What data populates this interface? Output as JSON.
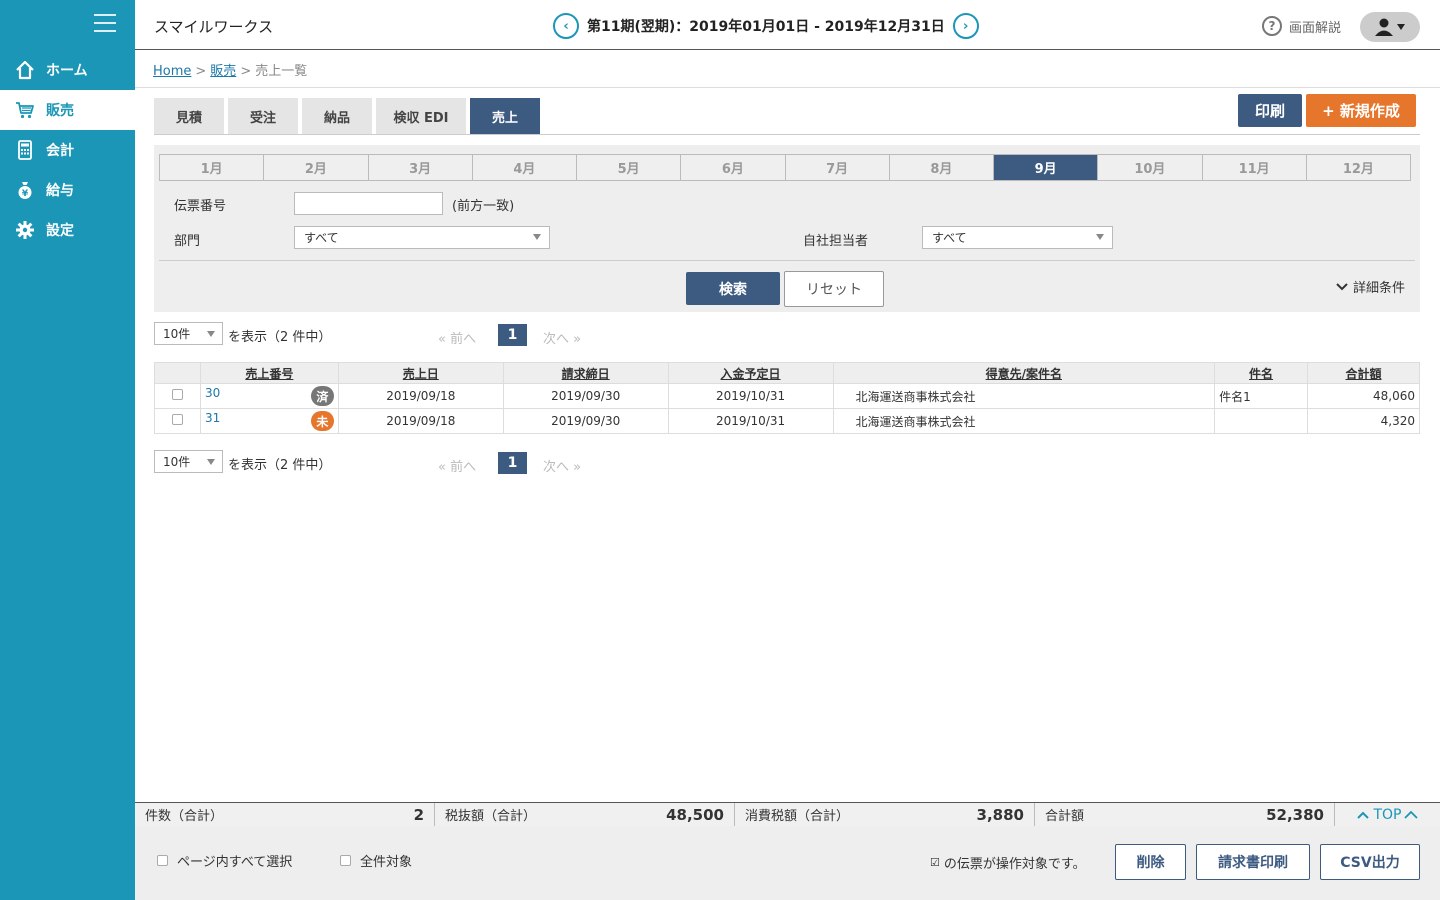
{
  "sidebar": {
    "items": [
      {
        "label": "ホーム",
        "icon": "home-icon"
      },
      {
        "label": "販売",
        "icon": "cart-icon"
      },
      {
        "label": "会計",
        "icon": "calculator-icon"
      },
      {
        "label": "給与",
        "icon": "money-bag-icon"
      },
      {
        "label": "設定",
        "icon": "gear-icon"
      }
    ],
    "active": "販売"
  },
  "header": {
    "app_title": "スマイルワークス",
    "period": "第11期(翌期)：2019年01月01日 - 2019年12月31日",
    "help": "画面解説"
  },
  "breadcrumb": {
    "home": "Home",
    "sales": "販売",
    "current": "売上一覧",
    "sep": ">"
  },
  "tabs": [
    {
      "label": "見積"
    },
    {
      "label": "受注"
    },
    {
      "label": "納品"
    },
    {
      "label": "検収 EDI"
    },
    {
      "label": "売上"
    }
  ],
  "actions": {
    "print": "印刷",
    "create": "+ 新規作成"
  },
  "search": {
    "months": [
      "1月",
      "2月",
      "3月",
      "4月",
      "5月",
      "6月",
      "7月",
      "8月",
      "9月",
      "10月",
      "11月",
      "12月"
    ],
    "active_month": "9月",
    "slip_label": "伝票番号",
    "slip_value": "",
    "slip_hint": "(前方一致)",
    "dept_label": "部門",
    "dept_value": "すべて",
    "staff_label": "自社担当者",
    "staff_value": "すべて",
    "search_btn": "検索",
    "reset_btn": "リセット",
    "detail": "詳細条件"
  },
  "pager": {
    "per_page": "10件",
    "summary": "を表示（2 件中）",
    "prev": "« 前へ",
    "page": "1",
    "next": "次へ »"
  },
  "table": {
    "headers": [
      "",
      "売上番号",
      "売上日",
      "請求締日",
      "入金予定日",
      "得意先/案件名",
      "件名",
      "合計額"
    ],
    "rows": [
      {
        "no": "30",
        "status": "済",
        "date": "2019/09/18",
        "close": "2019/09/30",
        "due": "2019/10/31",
        "client": "北海運送商事株式会社",
        "subject": "件名1",
        "total": "48,060"
      },
      {
        "no": "31",
        "status": "未",
        "date": "2019/09/18",
        "close": "2019/09/30",
        "due": "2019/10/31",
        "client": "北海運送商事株式会社",
        "subject": "",
        "total": "4,320"
      }
    ]
  },
  "totals": {
    "count_label": "件数（合計）",
    "count": "2",
    "net_label": "税抜額（合計）",
    "net": "48,500",
    "tax_label": "消費税額（合計）",
    "tax": "3,880",
    "total_label": "合計額",
    "total": "52,380",
    "top": "TOP"
  },
  "footer": {
    "select_page": "ページ内すべて選択",
    "select_all": "全件対象",
    "note": "の伝票が操作対象です。",
    "delete": "削除",
    "invoice_print": "請求書印刷",
    "csv": "CSV出力"
  },
  "colors": {
    "primary": "#1b96b7",
    "navy": "#3d5a80",
    "orange": "#e5762c"
  }
}
